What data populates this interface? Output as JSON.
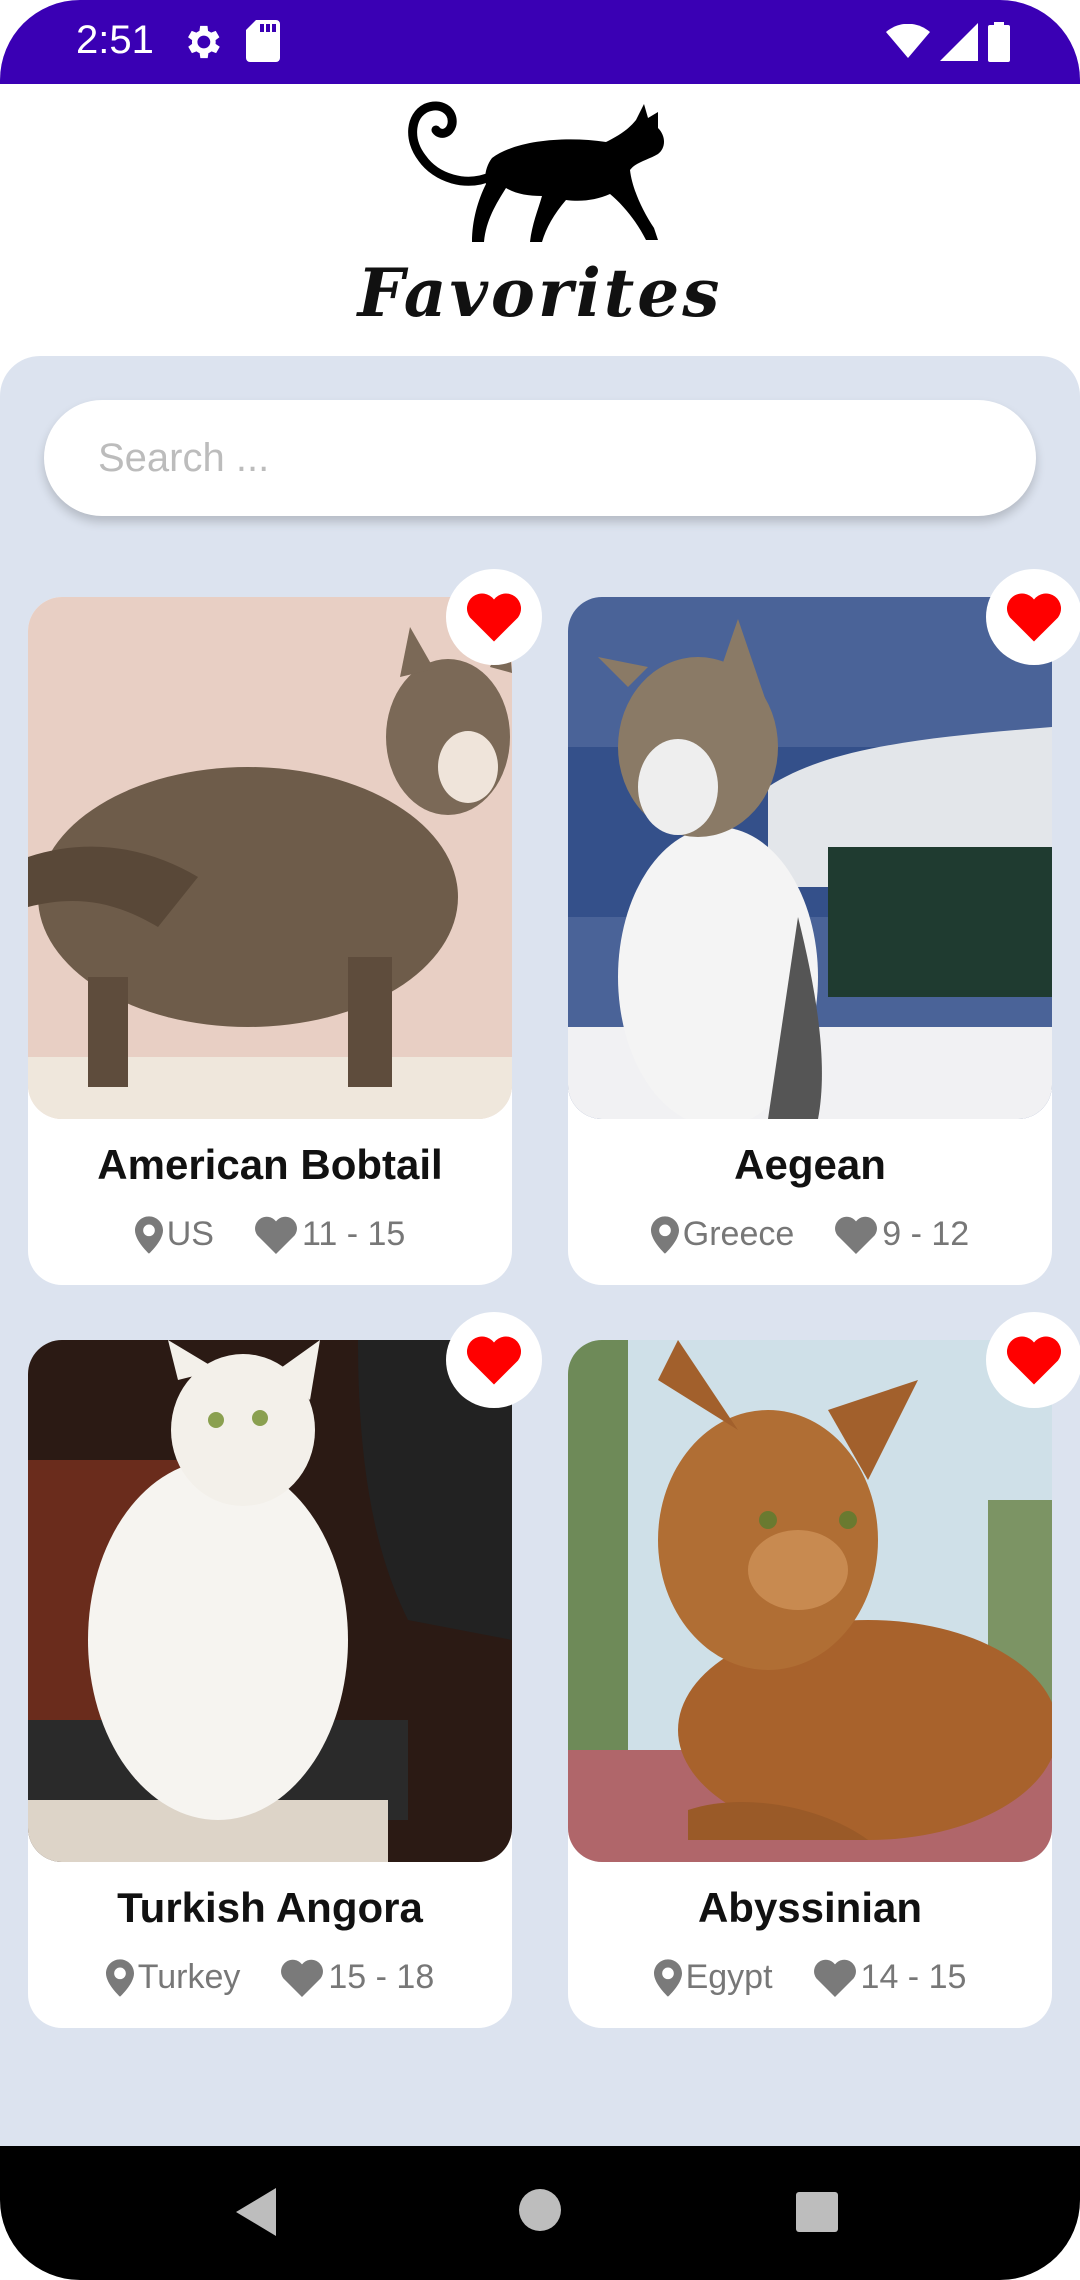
{
  "status_bar": {
    "time": "2:51",
    "icons": [
      "gear-icon",
      "sd-card-icon",
      "wifi-icon",
      "signal-icon",
      "battery-icon"
    ],
    "background": "#3a00b4"
  },
  "header": {
    "title": "Favorites",
    "logo": "cat-silhouette-logo"
  },
  "search": {
    "placeholder": "Search ...",
    "value": ""
  },
  "cats": [
    {
      "name": "American Bobtail",
      "origin": "US",
      "lifespan": "11 - 15",
      "favorite": true
    },
    {
      "name": "Aegean",
      "origin": "Greece",
      "lifespan": "9 - 12",
      "favorite": true
    },
    {
      "name": "Turkish Angora",
      "origin": "Turkey",
      "lifespan": "15 - 18",
      "favorite": true
    },
    {
      "name": "Abyssinian",
      "origin": "Egypt",
      "lifespan": "14 - 15",
      "favorite": true
    }
  ],
  "colors": {
    "panel": "#dce3ef",
    "heart": "#ff0000",
    "meta_text": "#777777"
  },
  "nav_bar": {
    "icons": [
      "back-icon",
      "home-icon",
      "recents-icon"
    ]
  }
}
